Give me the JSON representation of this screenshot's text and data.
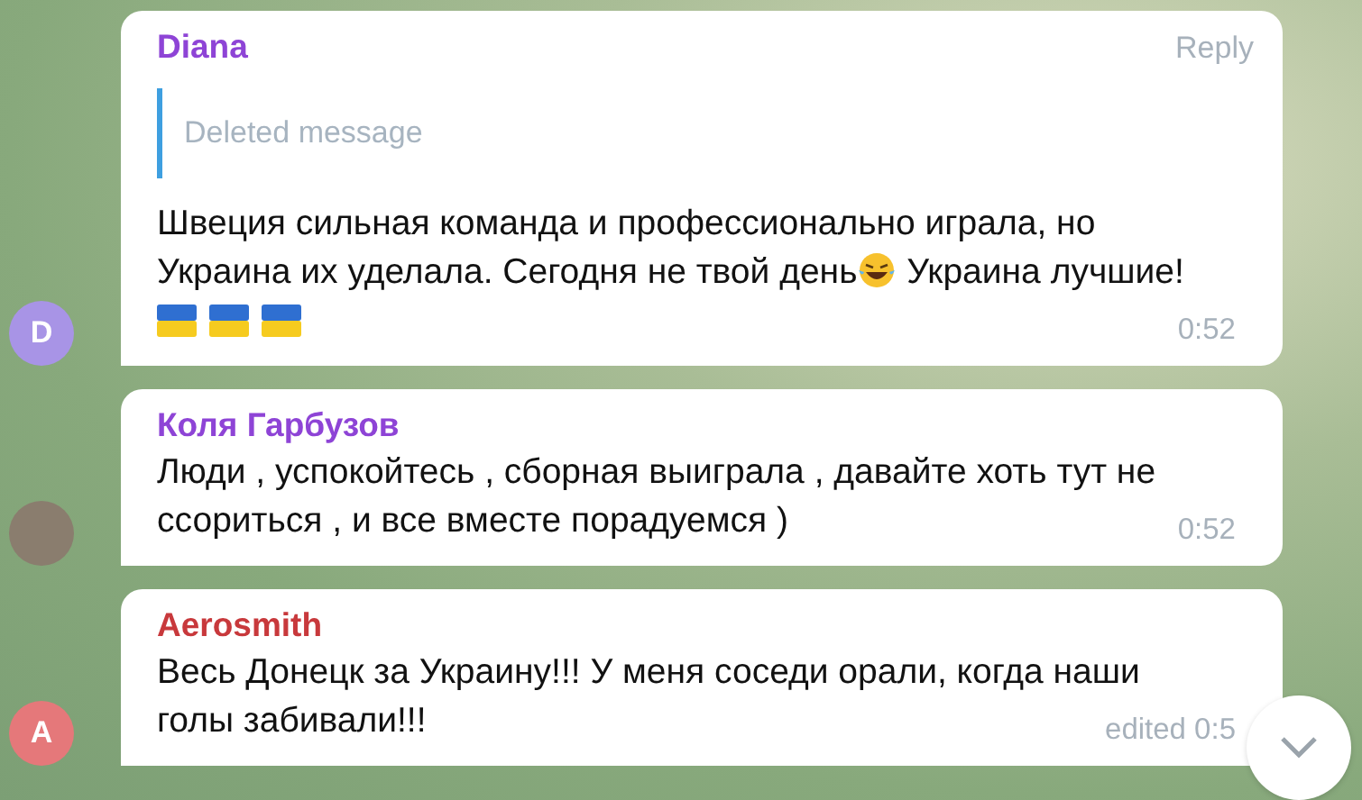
{
  "messages": [
    {
      "sender": "Diana",
      "color": "#8e44d6",
      "avatar": {
        "kind": "letter",
        "letter": "D",
        "color": "#a894e6"
      },
      "reply": {
        "label": "Reply",
        "quote": "Deleted message"
      },
      "body": [
        {
          "kind": "text",
          "text": "Швеция сильная команда и профессионально играла, но"
        },
        {
          "kind": "break"
        },
        {
          "kind": "text",
          "text": "Украина их уделала. Сегодня не твой день"
        },
        {
          "kind": "laughing-emoji"
        },
        {
          "kind": "text",
          "text": " Украина лучшие!"
        },
        {
          "kind": "break"
        },
        {
          "kind": "flag"
        },
        {
          "kind": "flag"
        },
        {
          "kind": "flag"
        }
      ],
      "time": "0:52"
    },
    {
      "sender": "Коля Гарбузов",
      "color": "#8e44d6",
      "avatar": {
        "kind": "photo"
      },
      "body": [
        {
          "kind": "text",
          "text": "Люди , успокойтесь , сборная выиграла , давайте хоть тут не"
        },
        {
          "kind": "break"
        },
        {
          "kind": "text",
          "text": "ссориться , и все вместе порадуемся )"
        }
      ],
      "time": "0:52"
    },
    {
      "sender": "Aerosmith",
      "color": "#c8393c",
      "avatar": {
        "kind": "letter",
        "letter": "A",
        "color": "#e5787a"
      },
      "body": [
        {
          "kind": "text",
          "text": "Весь Донецк за Украину!!! У меня соседи орали, когда наши"
        },
        {
          "kind": "break"
        },
        {
          "kind": "text",
          "text": "голы забивали!!!"
        }
      ],
      "time": "edited 0:5"
    }
  ]
}
